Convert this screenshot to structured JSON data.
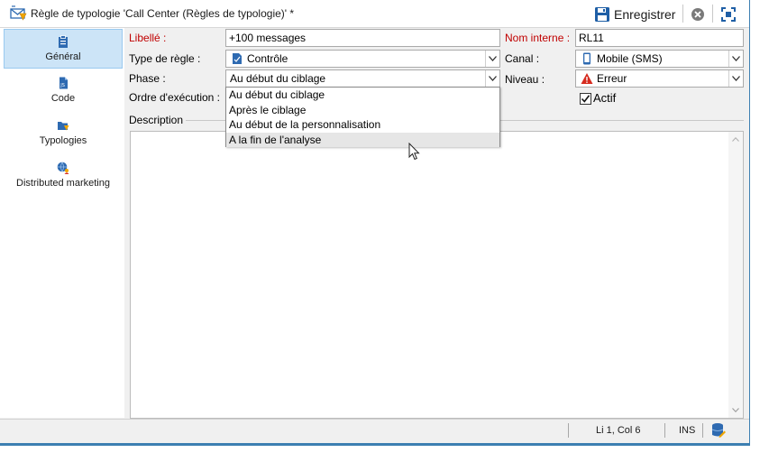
{
  "window": {
    "title": "Règle de typologie 'Call Center (Règles de typologie)' *",
    "title_icon": "typology-rule-icon",
    "toolbar": {
      "save_label": "Enregistrer",
      "save_icon": "floppy-disk-icon",
      "cancel_icon": "close-circle-icon",
      "maximize_icon": "maximize-icon"
    }
  },
  "nav": {
    "items": [
      {
        "label": "Général",
        "icon": "clipboard-icon",
        "active": true
      },
      {
        "label": "Code",
        "icon": "code-file-icon",
        "active": false
      },
      {
        "label": "Typologies",
        "icon": "typology-folder-icon",
        "active": false
      },
      {
        "label": "Distributed marketing",
        "icon": "globe-people-icon",
        "active": false
      }
    ]
  },
  "form": {
    "libelle": {
      "label": "Libellé :",
      "value": "+100 messages"
    },
    "nom_interne": {
      "label": "Nom interne :",
      "value": "RL11"
    },
    "type_regle": {
      "label": "Type de règle :",
      "value": "Contrôle",
      "icon": "control-rule-icon"
    },
    "canal": {
      "label": "Canal :",
      "value": "Mobile (SMS)",
      "icon": "mobile-phone-icon"
    },
    "phase": {
      "label": "Phase :",
      "value": "Au début du ciblage"
    },
    "niveau": {
      "label": "Niveau :",
      "value": "Erreur",
      "icon": "warning-triangle-icon"
    },
    "ordre": {
      "label": "Ordre d'exécution :"
    },
    "actif": {
      "label": "Actif",
      "checked": true
    },
    "description": {
      "label": "Description"
    }
  },
  "phase_dropdown": {
    "options": [
      "Au début du ciblage",
      "Après le ciblage",
      "Au début de la personnalisation",
      "A la fin de l'analyse"
    ],
    "hovered_index": 3
  },
  "statusbar": {
    "position": "Li 1, Col 6",
    "mode": "INS",
    "db_icon": "database-edit-icon"
  },
  "colors": {
    "accent_border": "#3c7fb1",
    "nav_active_bg": "#cce4f7",
    "required_label": "#c00000",
    "save_icon": "#1f5fa6",
    "warning": "#d62b1f"
  }
}
